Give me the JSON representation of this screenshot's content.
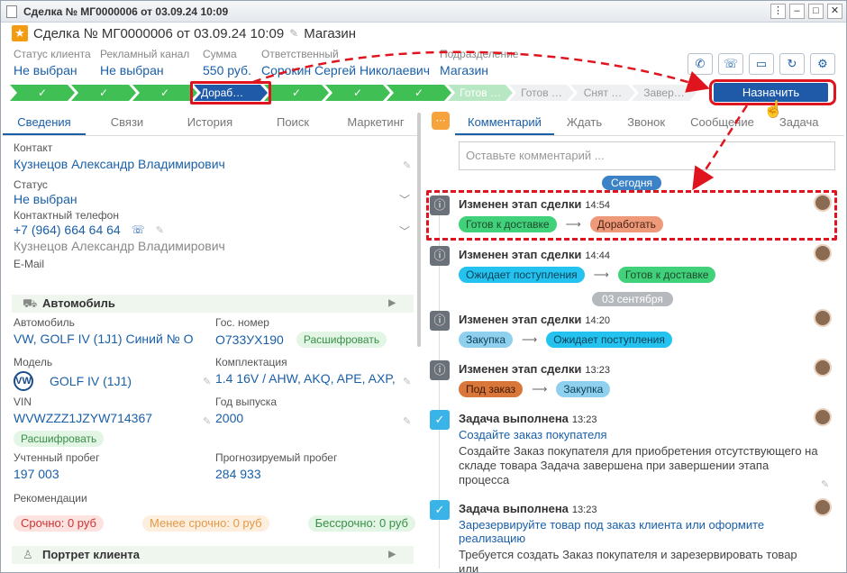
{
  "window": {
    "title": "Сделка № МГ0000006 от 03.09.24 10:09"
  },
  "header": {
    "title": "Сделка № МГ0000006 от 03.09.24 10:09",
    "shop": "Магазин"
  },
  "fields": [
    {
      "label": "Статус клиента",
      "value": "Не выбран"
    },
    {
      "label": "Рекламный канал",
      "value": "Не выбран"
    },
    {
      "label": "Сумма",
      "value": "550 руб."
    },
    {
      "label": "Ответственный",
      "value": "Сорокин Сергей Николаевич"
    },
    {
      "label": "Подразделение",
      "value": "Магазин"
    }
  ],
  "stages": {
    "current": "Дораб…",
    "check": "✓",
    "next": "Готов …",
    "future": [
      "Готов …",
      "Снят …",
      "Завер…"
    ]
  },
  "assign_label": "Назначить",
  "left_tabs": [
    "Сведения",
    "Связи",
    "История",
    "Поиск",
    "Маркетинг"
  ],
  "contact": {
    "contact_label": "Контакт",
    "contact_value": "Кузнецов Александр Владимирович",
    "status_label": "Статус",
    "status_value": "Не выбран",
    "phone_label": "Контактный телефон",
    "phone_value": "+7 (964) 664 64 64",
    "phone_owner": "Кузнецов Александр Владимирович",
    "email_label": "E-Mail"
  },
  "car": {
    "section_title": "Автомобиль",
    "car_label": "Автомобиль",
    "car_value": "VW, GOLF IV (1J1) Синий № O",
    "plate_label": "Гос. номер",
    "plate_value": "О733УХ190",
    "decode": "Расшифровать",
    "model_label": "Модель",
    "model_value": "GOLF IV (1J1)",
    "config_label": "Комплектация",
    "config_value": "1.4 16V / AHW, AKQ, APE, AXP,",
    "vin_label": "VIN",
    "vin_value": "WVWZZZ1JZYW714367",
    "year_label": "Год выпуска",
    "year_value": "2000",
    "vin_decode": "Расшифровать",
    "mileage_label": "Учтенный пробег",
    "mileage_value": "197 003",
    "forecast_label": "Прогнозируемый пробег",
    "forecast_value": "284 933",
    "reco_label": "Рекомендации",
    "reco": [
      "Срочно: 0 руб",
      "Менее срочно: 0 руб",
      "Бессрочно: 0 руб"
    ]
  },
  "portrait": {
    "title": "Портрет клиента"
  },
  "right_tabs": [
    "Комментарий",
    "Ждать",
    "Звонок",
    "Сообщение",
    "Задача"
  ],
  "comment_placeholder": "Оставьте комментарий ...",
  "dates": {
    "today": "Сегодня",
    "sep3": "03 сентября"
  },
  "events": [
    {
      "title": "Изменен этап сделки",
      "time": "14:54",
      "from": "Готов к доставке",
      "to": "Доработать"
    },
    {
      "title": "Изменен этап сделки",
      "time": "14:44",
      "from": "Ожидает поступления",
      "to": "Готов к доставке"
    },
    {
      "title": "Изменен этап сделки",
      "time": "14:20",
      "from": "Закупка",
      "to": "Ожидает поступления"
    },
    {
      "title": "Изменен этап сделки",
      "time": "13:23",
      "from": "Под заказ",
      "to": "Закупка"
    },
    {
      "title": "Задача выполнена",
      "time": "13:23",
      "link": "Создайте заказ покупателя",
      "text": "Создайте Заказ покупателя для приобретения отсутствующего на складе товара Задача завершена при завершении этапа процесса"
    },
    {
      "title": "Задача выполнена",
      "time": "13:23",
      "link": "Зарезервируйте товар под заказ клиента или оформите реализацию",
      "text": "Требуется создать Заказ покупателя и зарезервировать товар или"
    }
  ],
  "arrow_glyph": "⟶",
  "colors": {
    "accent": "#1f5aa8",
    "done": "#3fbf54",
    "annot": "#e0141e"
  }
}
